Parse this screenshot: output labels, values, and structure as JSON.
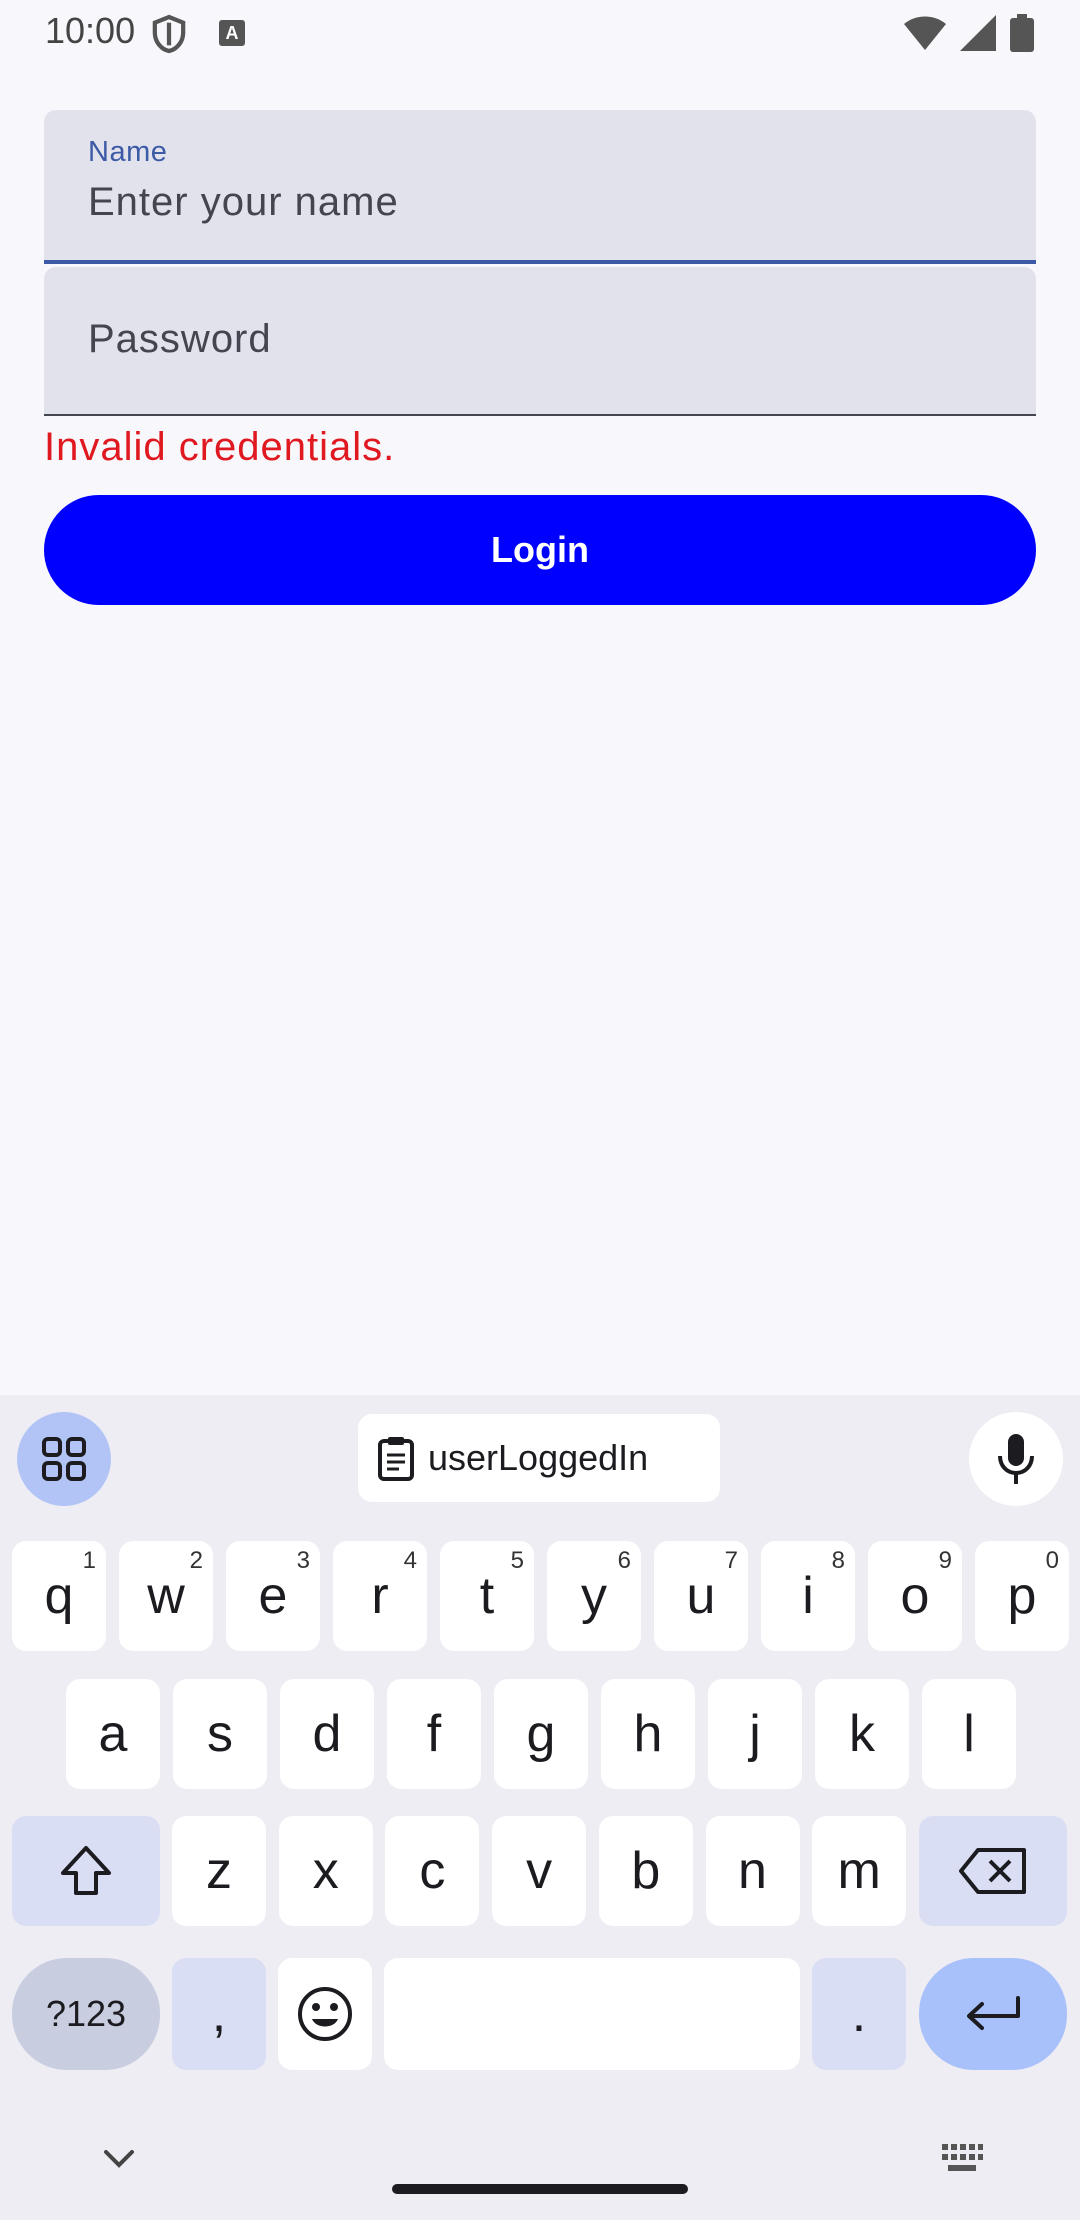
{
  "status_bar": {
    "time": "10:00"
  },
  "form": {
    "name_label": "Name",
    "name_placeholder": "Enter your name",
    "password_placeholder": "Password",
    "error": "Invalid credentials.",
    "login_label": "Login"
  },
  "keyboard": {
    "clipboard_suggestion": "userLoggedIn",
    "row1": [
      {
        "k": "q",
        "h": "1"
      },
      {
        "k": "w",
        "h": "2"
      },
      {
        "k": "e",
        "h": "3"
      },
      {
        "k": "r",
        "h": "4"
      },
      {
        "k": "t",
        "h": "5"
      },
      {
        "k": "y",
        "h": "6"
      },
      {
        "k": "u",
        "h": "7"
      },
      {
        "k": "i",
        "h": "8"
      },
      {
        "k": "o",
        "h": "9"
      },
      {
        "k": "p",
        "h": "0"
      }
    ],
    "row2": [
      "a",
      "s",
      "d",
      "f",
      "g",
      "h",
      "j",
      "k",
      "l"
    ],
    "row3": [
      "z",
      "x",
      "c",
      "v",
      "b",
      "n",
      "m"
    ],
    "symbols_key": "?123",
    "comma_key": ",",
    "period_key": "."
  }
}
